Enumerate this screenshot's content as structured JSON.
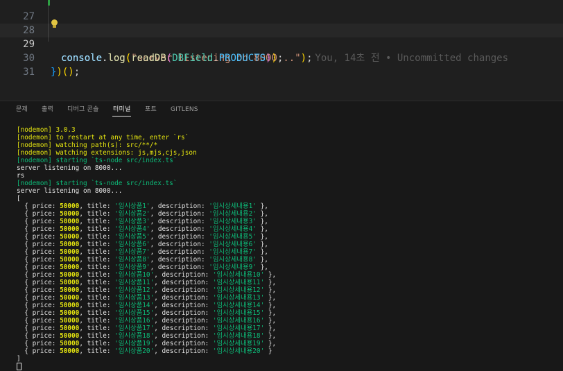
{
  "editor": {
    "lines": [
      {
        "num": "27"
      },
      {
        "num": "28",
        "text": {
          "obj": "console",
          "dot": ".",
          "fn": "log",
          "open": "(",
          "str": "\"server listening on 8000...\"",
          "close": ")",
          "semi": ";"
        }
      },
      {
        "num": "29",
        "text": {
          "obj": "console",
          "dot": ".",
          "fn": "log",
          "open": "(",
          "fn2": "readDB",
          "open2": "(",
          "cls": "DBField",
          "dot2": ".",
          "const": "PRODUCTS",
          "close2": ")",
          "close": ")",
          "semi": ";"
        },
        "blame": "You, 14초 전 • Uncommitted changes"
      },
      {
        "num": "30",
        "text": {
          "close_brace": "}",
          "paren": ")",
          "call": "()",
          "semi": ";"
        }
      },
      {
        "num": "31"
      }
    ]
  },
  "panel": {
    "tabs": [
      {
        "label": "문제"
      },
      {
        "label": "출력"
      },
      {
        "label": "디버그 콘솔"
      },
      {
        "label": "터미널",
        "active": true
      },
      {
        "label": "포트"
      },
      {
        "label": "GITLENS"
      }
    ]
  },
  "terminal": {
    "header_lines": [
      {
        "color": "yel",
        "text": "[nodemon] 3.0.3"
      },
      {
        "color": "yel",
        "text": "[nodemon] to restart at any time, enter `rs`"
      },
      {
        "color": "yel",
        "text": "[nodemon] watching path(s): src/**/*"
      },
      {
        "color": "yel",
        "text": "[nodemon] watching extensions: js,mjs,cjs,json"
      },
      {
        "color": "grn",
        "text": "[nodemon] starting `ts-node src/index.ts`"
      },
      {
        "color": "wht",
        "text": "server listening on 8000..."
      },
      {
        "color": "wht",
        "text": "rs"
      },
      {
        "color": "grn",
        "text": "[nodemon] starting `ts-node src/index.ts`"
      },
      {
        "color": "wht",
        "text": "server listening on 8000..."
      },
      {
        "color": "wht",
        "text": "["
      }
    ],
    "products": [
      {
        "price": "50000",
        "title": "'임시상품1'",
        "description": "'임시상세내용1'",
        "end": " },"
      },
      {
        "price": "50000",
        "title": "'임시상품2'",
        "description": "'임시상세내용2'",
        "end": " },"
      },
      {
        "price": "50000",
        "title": "'임시상품3'",
        "description": "'임시상세내용3'",
        "end": " },"
      },
      {
        "price": "50000",
        "title": "'임시상품4'",
        "description": "'임시상세내용4'",
        "end": " },"
      },
      {
        "price": "50000",
        "title": "'임시상품5'",
        "description": "'임시상세내용5'",
        "end": " },"
      },
      {
        "price": "50000",
        "title": "'임시상품6'",
        "description": "'임시상세내용6'",
        "end": " },"
      },
      {
        "price": "50000",
        "title": "'임시상품7'",
        "description": "'임시상세내용7'",
        "end": " },"
      },
      {
        "price": "50000",
        "title": "'임시상품8'",
        "description": "'임시상세내용8'",
        "end": " },"
      },
      {
        "price": "50000",
        "title": "'임시상품9'",
        "description": "'임시상세내용9'",
        "end": " },"
      },
      {
        "price": "50000",
        "title": "'임시상품10'",
        "description": "'임시상세내용10'",
        "end": " },"
      },
      {
        "price": "50000",
        "title": "'임시상품11'",
        "description": "'임시상세내용11'",
        "end": " },"
      },
      {
        "price": "50000",
        "title": "'임시상품12'",
        "description": "'임시상세내용12'",
        "end": " },"
      },
      {
        "price": "50000",
        "title": "'임시상품13'",
        "description": "'임시상세내용13'",
        "end": " },"
      },
      {
        "price": "50000",
        "title": "'임시상품14'",
        "description": "'임시상세내용14'",
        "end": " },"
      },
      {
        "price": "50000",
        "title": "'임시상품15'",
        "description": "'임시상세내용15'",
        "end": " },"
      },
      {
        "price": "50000",
        "title": "'임시상품16'",
        "description": "'임시상세내용16'",
        "end": " },"
      },
      {
        "price": "50000",
        "title": "'임시상품17'",
        "description": "'임시상세내용17'",
        "end": " },"
      },
      {
        "price": "50000",
        "title": "'임시상품18'",
        "description": "'임시상세내용18'",
        "end": " },"
      },
      {
        "price": "50000",
        "title": "'임시상품19'",
        "description": "'임시상세내용19'",
        "end": " },"
      },
      {
        "price": "50000",
        "title": "'임시상품20'",
        "description": "'임시상세내용20'",
        "end": " }"
      }
    ],
    "closing": "]",
    "labels": {
      "open": "  { price: ",
      "title_key": ", title: ",
      "desc_key": ", description: "
    }
  },
  "colors": {
    "background": "#1e1e1e",
    "panel_background": "#181818",
    "terminal_yellow": "#e5e510",
    "terminal_green": "#0dbc79",
    "git_added": "#2ea043"
  }
}
